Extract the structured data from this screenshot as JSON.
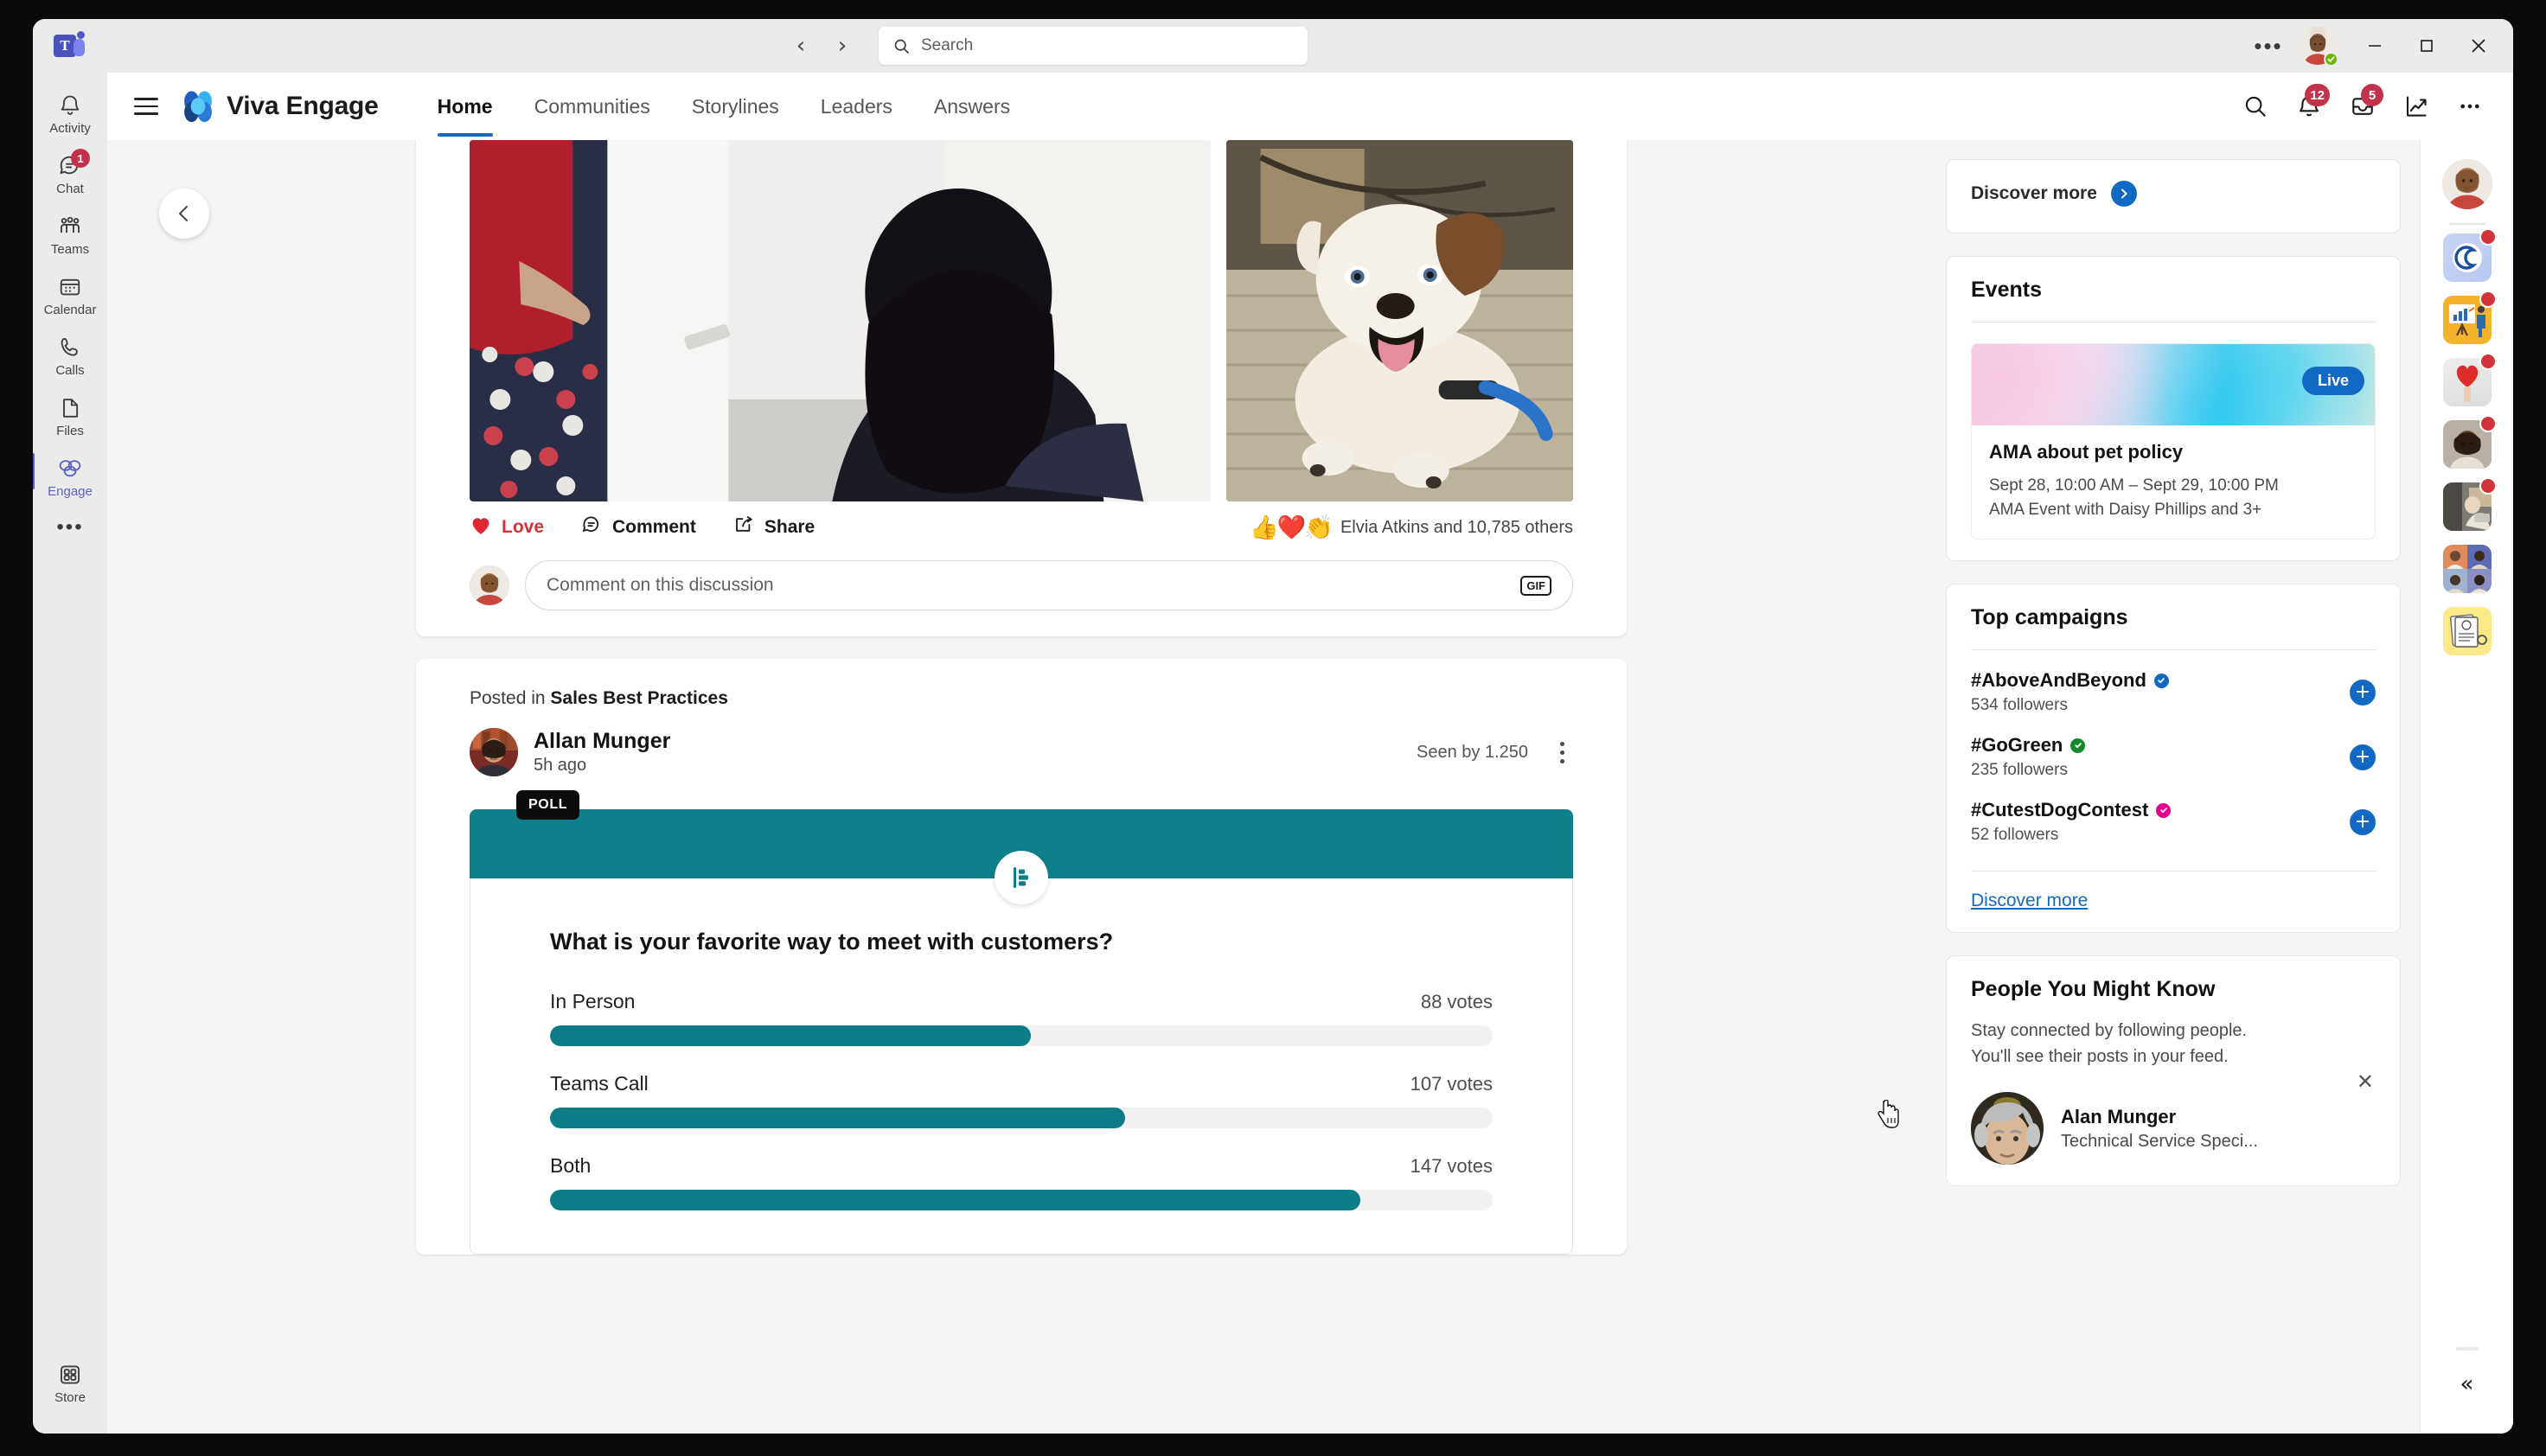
{
  "titlebar": {
    "app_icon": "teams-logo",
    "app_initial": "T",
    "back_label": "‹",
    "forward_label": "›",
    "search_placeholder": "Search",
    "more_label": "•••",
    "minimize_label": "—",
    "maximize_label": "☐",
    "close_label": "✕",
    "presence": "available"
  },
  "rail": {
    "items": [
      {
        "label": "Activity",
        "icon": "bell-icon",
        "badge": ""
      },
      {
        "label": "Chat",
        "icon": "chat-icon",
        "badge": "1"
      },
      {
        "label": "Teams",
        "icon": "teams-people-icon",
        "badge": ""
      },
      {
        "label": "Calendar",
        "icon": "calendar-icon",
        "badge": ""
      },
      {
        "label": "Calls",
        "icon": "phone-icon",
        "badge": ""
      },
      {
        "label": "Files",
        "icon": "file-icon",
        "badge": ""
      },
      {
        "label": "Engage",
        "icon": "engage-icon",
        "badge": ""
      }
    ],
    "more_label": "•••",
    "store": {
      "label": "Store",
      "icon": "store-grid-icon"
    }
  },
  "engage_header": {
    "menu_icon": "hamburger-icon",
    "brand": "Viva Engage",
    "tabs": [
      {
        "label": "Home",
        "active": true
      },
      {
        "label": "Communities",
        "active": false
      },
      {
        "label": "Storylines",
        "active": false
      },
      {
        "label": "Leaders",
        "active": false
      },
      {
        "label": "Answers",
        "active": false
      }
    ],
    "actions": [
      {
        "icon": "search-icon",
        "badge": ""
      },
      {
        "icon": "bell-icon",
        "badge": "12"
      },
      {
        "icon": "inbox-icon",
        "badge": "5"
      },
      {
        "icon": "analytics-icon",
        "badge": ""
      },
      {
        "icon": "more-horizontal-icon",
        "badge": ""
      }
    ]
  },
  "feed": {
    "carousel_back_label": "‹",
    "post1": {
      "images": [
        {
          "alt": "two colleagues talking in an office hallway"
        },
        {
          "alt": "english bulldog lying on office carpet"
        }
      ],
      "actions": [
        {
          "label": "Love",
          "icon": "heart-icon",
          "active": true
        },
        {
          "label": "Comment",
          "icon": "comment-icon",
          "active": false
        },
        {
          "label": "Share",
          "icon": "share-icon",
          "active": false
        }
      ],
      "reaction_emojis": "👍❤️👏",
      "reaction_text": "Elvia Atkins and 10,785 others",
      "comment_placeholder": "Comment on this discussion",
      "gif_label": "GIF"
    },
    "post2": {
      "posted_in_prefix": "Posted in ",
      "community": "Sales Best Practices",
      "author": "Allan Munger",
      "timestamp": "5h ago",
      "seen_by": "Seen by 1.250",
      "menu_icon": "kebab-menu-icon",
      "poll_tag": "POLL",
      "poll_icon": "poll-bars-icon"
    }
  },
  "chart_data": {
    "type": "bar",
    "title": "What is your favorite way to meet with customers?",
    "orientation": "horizontal",
    "categories": [
      "In Person",
      "Teams Call",
      "Both"
    ],
    "values": [
      88,
      107,
      147
    ],
    "value_labels": [
      "88 votes",
      "107 votes",
      "147 votes"
    ],
    "value_suffix": "votes",
    "max_value": 160,
    "fill_percent": [
      51,
      61,
      86
    ],
    "bar_color": "#0e7c86",
    "track_color": "#f1f1f1",
    "header_color": "#0e8089",
    "xlabel": "",
    "ylabel": "",
    "grid": false,
    "legend": false
  },
  "right_column": {
    "discover_more_top": {
      "label": "Discover more",
      "icon": "chevron-circle-right-icon"
    },
    "events": {
      "title": "Events",
      "items": [
        {
          "badge": "Live",
          "name": "AMA about pet policy",
          "time": "Sept 28, 10:00 AM – Sept 29, 10:00 PM",
          "detail": "AMA Event with Daisy Phillips and 3+"
        }
      ]
    },
    "top_campaigns": {
      "title": "Top campaigns",
      "items": [
        {
          "tag": "#AboveAndBeyond",
          "followers": "534 followers",
          "badge_color": "#1269c4",
          "follow_label": "+"
        },
        {
          "tag": "#GoGreen",
          "followers": "235 followers",
          "badge_color": "#128a2b",
          "follow_label": "+"
        },
        {
          "tag": "#CutestDogContest",
          "followers": "52 followers",
          "badge_color": "#e3008c",
          "follow_label": "+"
        }
      ],
      "discover_more": "Discover more"
    },
    "people_you_might_know": {
      "title": "People You Might Know",
      "subtitle": "Stay connected by following people.\nYou'll see their posts in your feed.",
      "close_label": "✕",
      "items": [
        {
          "name": "Alan Munger",
          "role": "Technical Service Speci..."
        }
      ]
    }
  },
  "app_rail": {
    "avatar": "user-avatar",
    "tiles": [
      {
        "icon": "copilot-app-icon",
        "has_badge": true
      },
      {
        "icon": "presentation-app-icon",
        "has_badge": true
      },
      {
        "icon": "heart-app-icon",
        "has_badge": true
      },
      {
        "icon": "person-app-icon",
        "has_badge": true
      },
      {
        "icon": "worker-app-icon",
        "has_badge": true
      },
      {
        "icon": "people-grid-app-icon",
        "has_badge": false
      },
      {
        "icon": "documents-app-icon",
        "has_badge": false
      }
    ],
    "collapse_label": "«"
  }
}
